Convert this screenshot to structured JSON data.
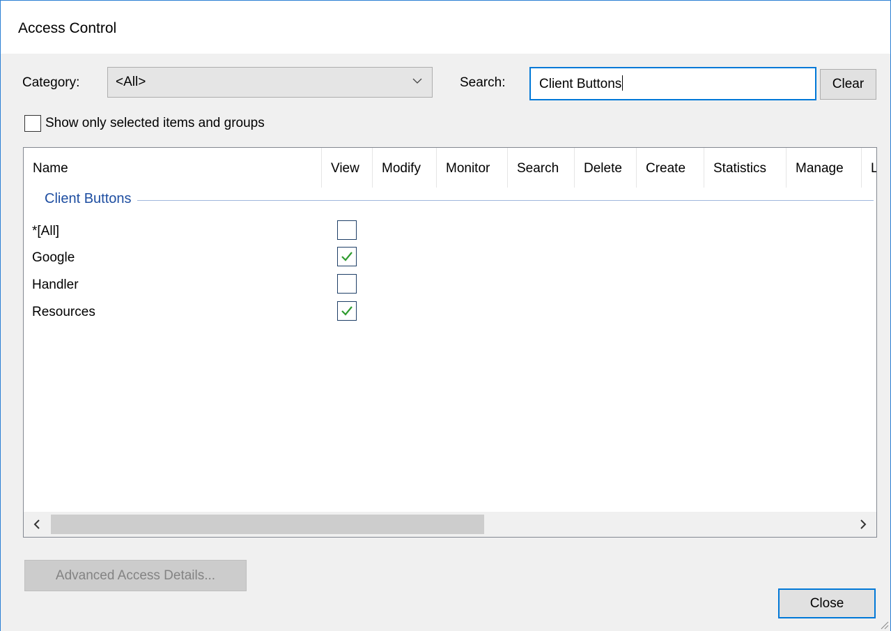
{
  "window": {
    "title": "Access Control"
  },
  "filters": {
    "category_label": "Category:",
    "category_value": "<All>",
    "search_label": "Search:",
    "search_value": "Client Buttons",
    "clear_label": "Clear",
    "show_only_label": "Show only selected items and groups",
    "show_only_checked": false
  },
  "columns": [
    "Name",
    "View",
    "Modify",
    "Monitor",
    "Search",
    "Delete",
    "Create",
    "Statistics",
    "Manage",
    "L"
  ],
  "group": {
    "title": "Client Buttons"
  },
  "rows": [
    {
      "name": "*[All]",
      "view_checked": false
    },
    {
      "name": "Google",
      "view_checked": true
    },
    {
      "name": "Handler",
      "view_checked": false
    },
    {
      "name": "Resources",
      "view_checked": true
    }
  ],
  "footer": {
    "advanced_label": "Advanced Access Details...",
    "close_label": "Close"
  },
  "colors": {
    "accent": "#0078d7",
    "check": "#2e9b2e",
    "group_title": "#1e4ea1"
  }
}
